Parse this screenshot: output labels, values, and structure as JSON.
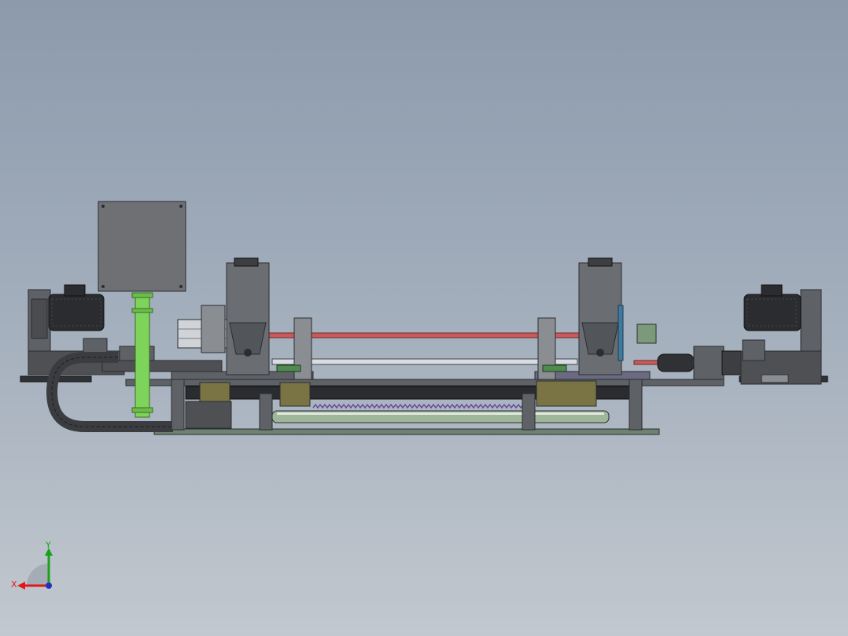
{
  "viewport": {
    "background_top": "#8c9aac",
    "background_bottom": "#c2c8cf"
  },
  "triad": {
    "x_label": "X",
    "y_label": "Y",
    "x_color": "#e01818",
    "y_color": "#1aa01a",
    "z_color": "#2030c0"
  },
  "colors": {
    "steel": "#5e6166",
    "steel_dark": "#3c3e42",
    "steel_light": "#8a8d92",
    "motor": "#2a2c30",
    "panel": "#6e7074",
    "green_pipe": "#7ed35a",
    "red_rod": "#c85a5a",
    "silver_rod": "#d8dde3",
    "olive_block": "#7a7444",
    "base_plate": "#6d8272"
  }
}
